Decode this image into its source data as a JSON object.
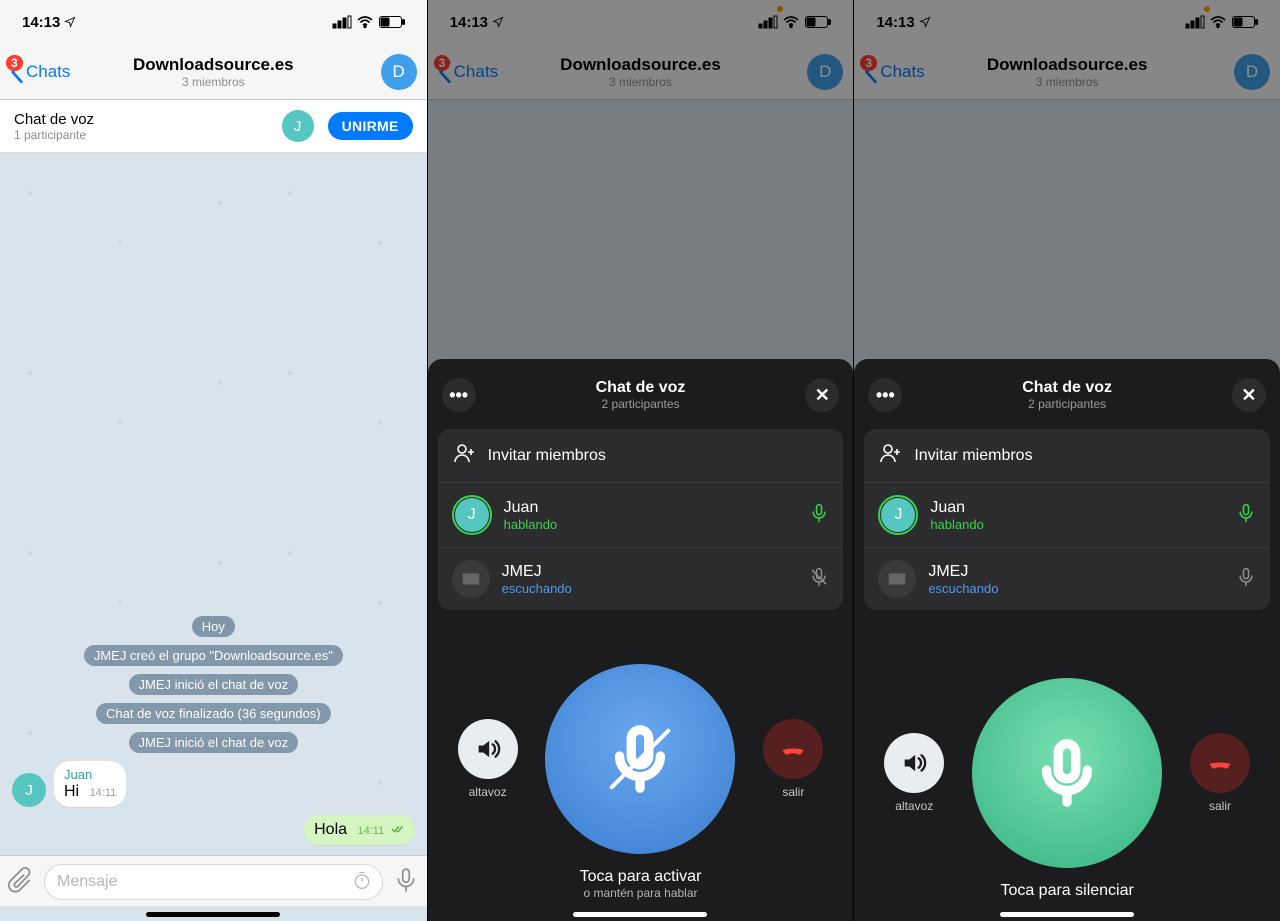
{
  "status": {
    "time": "14:13"
  },
  "nav": {
    "back": "Chats",
    "badge": "3",
    "title": "Downloadsource.es",
    "sub": "3 miembros",
    "avatar_letter": "D"
  },
  "vc_banner": {
    "title": "Chat de voz",
    "sub": "1 participante",
    "avatar_letter": "J",
    "join": "UNIRME"
  },
  "chat": {
    "date": "Hoy",
    "sys": [
      "JMEJ creó el grupo \"Downloadsource.es\"",
      "JMEJ inició el chat de voz",
      "Chat de voz finalizado (36 segundos)",
      "JMEJ inició el chat de voz"
    ],
    "msg_in": {
      "avatar": "J",
      "name": "Juan",
      "text": "Hi",
      "time": "14:11"
    },
    "msg_out": {
      "text": "Hola",
      "time": "14:11"
    },
    "placeholder": "Mensaje"
  },
  "sheet": {
    "title": "Chat de voz",
    "sub": "2 participantes",
    "invite": "Invitar miembros",
    "p1": {
      "name": "Juan",
      "status": "hablando",
      "avatar": "J"
    },
    "p2": {
      "name": "JMEJ",
      "status": "escuchando"
    },
    "speaker": "altavoz",
    "leave": "salir",
    "tap_activate": "Toca para activar",
    "hold_talk": "o mantén para hablar",
    "tap_mute": "Toca para silenciar"
  }
}
